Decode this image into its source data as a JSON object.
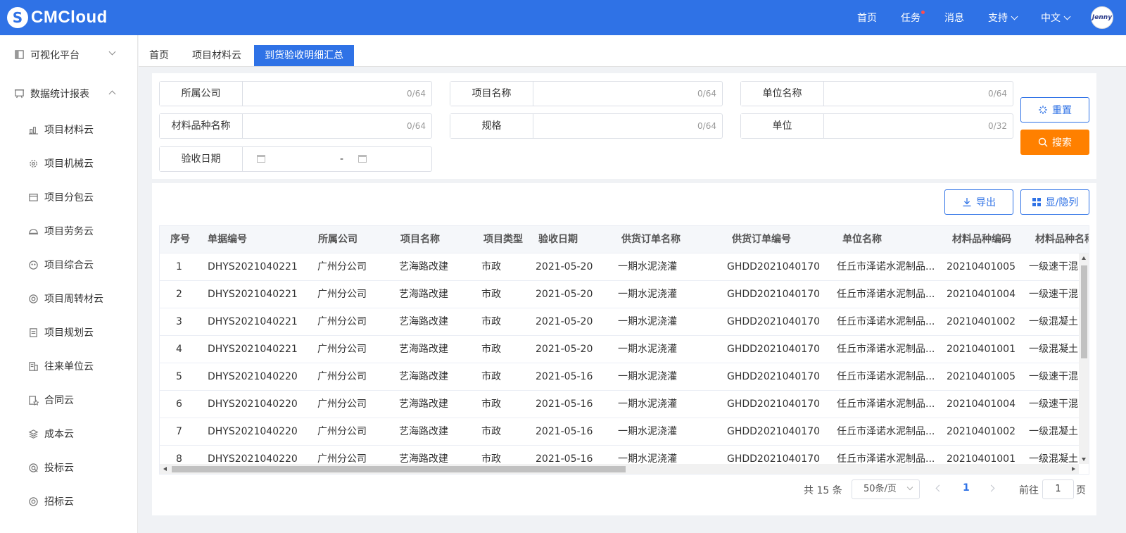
{
  "header": {
    "logo_text": "CMCloud",
    "nav": [
      {
        "label": "首页"
      },
      {
        "label": "任务"
      },
      {
        "label": "消息"
      },
      {
        "label": "支持"
      },
      {
        "label": "中文"
      }
    ],
    "avatar_text": "Jenny"
  },
  "sidebar": {
    "groups": [
      {
        "label": "可视化平台"
      },
      {
        "label": "数据统计报表"
      }
    ],
    "items": [
      {
        "label": "项目材料云",
        "icon": "chart-icon"
      },
      {
        "label": "项目机械云",
        "icon": "gear-icon"
      },
      {
        "label": "项目分包云",
        "icon": "window-icon"
      },
      {
        "label": "项目劳务云",
        "icon": "helmet-icon"
      },
      {
        "label": "项目综合云",
        "icon": "grid-icon"
      },
      {
        "label": "项目周转材云",
        "icon": "rotate-icon"
      },
      {
        "label": "项目规划云",
        "icon": "document-icon"
      },
      {
        "label": "往来单位云",
        "icon": "building-icon"
      },
      {
        "label": "合同云",
        "icon": "contract-icon"
      },
      {
        "label": "成本云",
        "icon": "layers-icon"
      },
      {
        "label": "投标云",
        "icon": "target-icon"
      },
      {
        "label": "招标云",
        "icon": "target-icon"
      }
    ]
  },
  "tabs": [
    {
      "label": "首页"
    },
    {
      "label": "项目材料云"
    },
    {
      "label": "到货验收明细汇总"
    }
  ],
  "filters": {
    "company": {
      "label": "所属公司",
      "count": "0/64"
    },
    "project": {
      "label": "项目名称",
      "count": "0/64"
    },
    "unit_name": {
      "label": "单位名称",
      "count": "0/64"
    },
    "material": {
      "label": "材料品种名称",
      "count": "0/64"
    },
    "spec": {
      "label": "规格",
      "count": "0/64"
    },
    "unit": {
      "label": "单位",
      "count": "0/32"
    },
    "date": {
      "label": "验收日期",
      "separator": "-"
    }
  },
  "buttons": {
    "reset": "重置",
    "search": "搜索",
    "export": "导出",
    "columns": "显/隐列"
  },
  "table": {
    "columns": [
      "序号",
      "单据编号",
      "所属公司",
      "项目名称",
      "项目类型",
      "验收日期",
      "供货订单名称",
      "供货订单编号",
      "单位名称",
      "材料品种编码",
      "材料品种名称"
    ],
    "rows": [
      [
        "1",
        "DHYS2021040221",
        "广州分公司",
        "艺海路改建",
        "市政",
        "2021-05-20",
        "一期水泥浇灌",
        "GHDD2021040170",
        "任丘市泽诺水泥制品...",
        "20210401005",
        "一级速干混"
      ],
      [
        "2",
        "DHYS2021040221",
        "广州分公司",
        "艺海路改建",
        "市政",
        "2021-05-20",
        "一期水泥浇灌",
        "GHDD2021040170",
        "任丘市泽诺水泥制品...",
        "20210401004",
        "一级速干混"
      ],
      [
        "3",
        "DHYS2021040221",
        "广州分公司",
        "艺海路改建",
        "市政",
        "2021-05-20",
        "一期水泥浇灌",
        "GHDD2021040170",
        "任丘市泽诺水泥制品...",
        "20210401002",
        "一级混凝土"
      ],
      [
        "4",
        "DHYS2021040221",
        "广州分公司",
        "艺海路改建",
        "市政",
        "2021-05-20",
        "一期水泥浇灌",
        "GHDD2021040170",
        "任丘市泽诺水泥制品...",
        "20210401001",
        "一级混凝土"
      ],
      [
        "5",
        "DHYS2021040220",
        "广州分公司",
        "艺海路改建",
        "市政",
        "2021-05-16",
        "一期水泥浇灌",
        "GHDD2021040170",
        "任丘市泽诺水泥制品...",
        "20210401005",
        "一级速干混"
      ],
      [
        "6",
        "DHYS2021040220",
        "广州分公司",
        "艺海路改建",
        "市政",
        "2021-05-16",
        "一期水泥浇灌",
        "GHDD2021040170",
        "任丘市泽诺水泥制品...",
        "20210401004",
        "一级速干混"
      ],
      [
        "7",
        "DHYS2021040220",
        "广州分公司",
        "艺海路改建",
        "市政",
        "2021-05-16",
        "一期水泥浇灌",
        "GHDD2021040170",
        "任丘市泽诺水泥制品...",
        "20210401002",
        "一级混凝土"
      ],
      [
        "8",
        "DHYS2021040220",
        "广州分公司",
        "艺海路改建",
        "市政",
        "2021-05-16",
        "一期水泥浇灌",
        "GHDD2021040170",
        "任丘市泽诺水泥制品...",
        "20210401001",
        "一级混凝土"
      ]
    ]
  },
  "pager": {
    "total": "共 15 条",
    "page_size": "50条/页",
    "current_page": "1",
    "goto_label": "前往",
    "goto_value": "1",
    "goto_unit": "页"
  },
  "colors": {
    "brand": "#2f72e6",
    "search": "#ff8000"
  }
}
